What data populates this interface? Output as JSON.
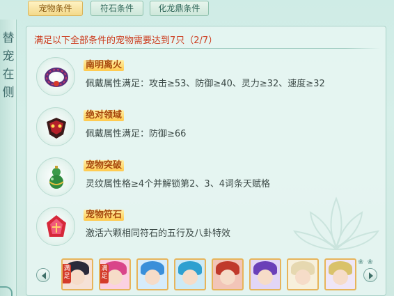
{
  "tabs": [
    {
      "label": "宠物条件",
      "active": true
    },
    {
      "label": "符石条件",
      "active": false
    },
    {
      "label": "化龙鼎条件",
      "active": false
    }
  ],
  "side_title": "替宠在侧",
  "header": {
    "requirement_text": "满足以下全部条件的宠物需要达到7只（2/7）"
  },
  "conditions": [
    {
      "icon": "bracelet-icon",
      "title": "南明离火",
      "desc": "佩戴属性满足：攻击≥53、防御≥40、灵力≥32、速度≥32"
    },
    {
      "icon": "mask-icon",
      "title": "绝对领域",
      "desc": "佩戴属性满足：防御≥66"
    },
    {
      "icon": "gourd-icon",
      "title": "宠物突破",
      "desc": "灵纹属性格≥4个并解锁第2、3、4词条天赋格"
    },
    {
      "icon": "talisman-stone-icon",
      "title": "宠物符石",
      "desc": "激活六颗相同符石的五行及八卦特效"
    }
  ],
  "pet_strip": {
    "badge_text": "满足",
    "pets": [
      {
        "name": "pet-1",
        "hair": "#2a2a3a",
        "bg": "#f6e2d6",
        "badge": true
      },
      {
        "name": "pet-2",
        "hair": "#d9458a",
        "bg": "#fbd1e2",
        "badge": true
      },
      {
        "name": "pet-3",
        "hair": "#3a8fd9",
        "bg": "#d6ecfb",
        "badge": false
      },
      {
        "name": "pet-4",
        "hair": "#2ea0d0",
        "bg": "#cdeaf6",
        "badge": false
      },
      {
        "name": "pet-5",
        "hair": "#c0392b",
        "bg": "#f2c5b8",
        "badge": false
      },
      {
        "name": "pet-6",
        "hair": "#6a3fb8",
        "bg": "#e2d6f6",
        "badge": false
      },
      {
        "name": "pet-7",
        "hair": "#e6d8b0",
        "bg": "#f7f0dc",
        "badge": false
      },
      {
        "name": "pet-8",
        "hair": "#d9c26a",
        "bg": "#efe6f7",
        "badge": false
      }
    ]
  },
  "colors": {
    "accent_red": "#cc3a1c",
    "title_orange": "#a7480c",
    "tab_active": "#f3d98a",
    "tab_inactive": "#cde7da"
  }
}
